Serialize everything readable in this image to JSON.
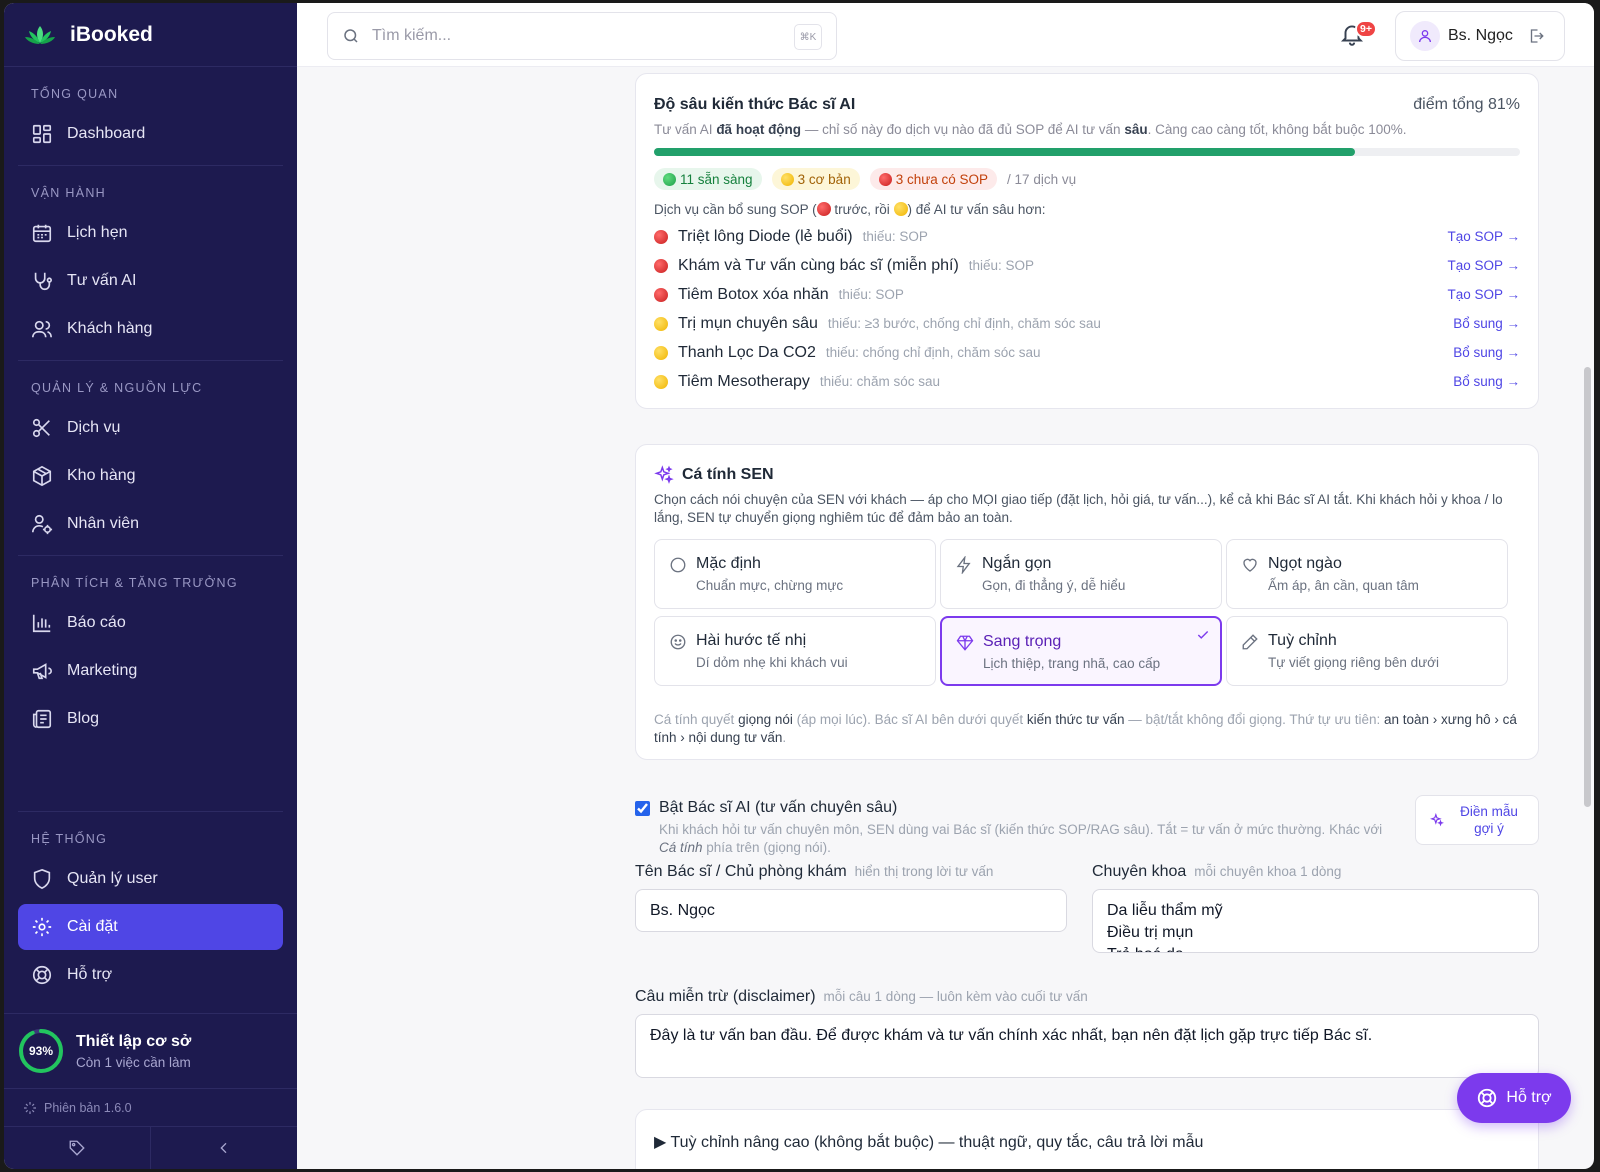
{
  "brand": {
    "name": "iBooked"
  },
  "sidebar": {
    "sections": [
      {
        "label": "TỔNG QUAN",
        "items": [
          {
            "label": "Dashboard",
            "icon": "dashboard-icon"
          }
        ]
      },
      {
        "label": "VẬN HÀNH",
        "items": [
          {
            "label": "Lịch hẹn",
            "icon": "calendar-icon"
          },
          {
            "label": "Tư vấn AI",
            "icon": "stethoscope-icon"
          },
          {
            "label": "Khách hàng",
            "icon": "users-icon"
          }
        ]
      },
      {
        "label": "QUẢN LÝ & NGUỒN LỰC",
        "items": [
          {
            "label": "Dịch vụ",
            "icon": "scissors-icon"
          },
          {
            "label": "Kho hàng",
            "icon": "box-icon"
          },
          {
            "label": "Nhân viên",
            "icon": "user-gear-icon"
          }
        ]
      },
      {
        "label": "PHÂN TÍCH & TĂNG TRƯỞNG",
        "items": [
          {
            "label": "Báo cáo",
            "icon": "bar-chart-icon"
          },
          {
            "label": "Marketing",
            "icon": "megaphone-icon"
          },
          {
            "label": "Blog",
            "icon": "newspaper-icon"
          }
        ]
      },
      {
        "label": "HỆ THỐNG",
        "items": [
          {
            "label": "Quản lý user",
            "icon": "shield-icon"
          },
          {
            "label": "Cài đặt",
            "icon": "gear-icon",
            "active": true
          },
          {
            "label": "Hỗ trợ",
            "icon": "lifebuoy-icon"
          }
        ]
      }
    ],
    "setup": {
      "percent_label": "93%",
      "percent": 0.93,
      "title": "Thiết lập cơ sở",
      "subtitle": "Còn 1 việc cần làm"
    },
    "version": "Phiên bản 1.6.0"
  },
  "topbar": {
    "search_placeholder": "Tìm kiếm...",
    "shortcut": "⌘K",
    "notif_badge": "9+",
    "user_name": "Bs. Ngọc"
  },
  "knowledge": {
    "title": "Độ sâu kiến thức Bác sĩ AI",
    "score": "điểm tổng 81%",
    "score_value": 0.81,
    "sub_a": "Tư vấn AI ",
    "sub_b": "đã hoạt động",
    "sub_c": " — chỉ số này đo dịch vụ nào đã đủ SOP để AI tư vấn ",
    "sub_d": "sâu",
    "sub_e": ". Càng cao càng tốt, không bắt buộc 100%.",
    "pill_ready": "11 sẵn sàng",
    "pill_basic": "3 cơ bản",
    "pill_nosop": "3 chưa có SOP",
    "total": "/ 17 dịch vụ",
    "list_title_a": "Dịch vụ cần bổ sung SOP (",
    "list_title_b": " trước, rồi ",
    "list_title_c": ") để AI tư vấn sâu hơn:",
    "services": [
      {
        "status": "red",
        "name": "Triệt lông Diode (lẻ buổi)",
        "missing": "thiếu: SOP",
        "action": "Tạo SOP →"
      },
      {
        "status": "red",
        "name": "Khám và Tư vấn cùng bác sĩ (miễn phí)",
        "missing": "thiếu: SOP",
        "action": "Tạo SOP →"
      },
      {
        "status": "red",
        "name": "Tiêm Botox xóa nhăn",
        "missing": "thiếu: SOP",
        "action": "Tạo SOP →"
      },
      {
        "status": "yellow",
        "name": "Trị mụn chuyên sâu",
        "missing": "thiếu: ≥3 bước, chống chỉ định, chăm sóc sau",
        "action": "Bổ sung →"
      },
      {
        "status": "yellow",
        "name": "Thanh Lọc Da CO2",
        "missing": "thiếu: chống chỉ định, chăm sóc sau",
        "action": "Bổ sung →"
      },
      {
        "status": "yellow",
        "name": "Tiêm Mesotherapy",
        "missing": "thiếu: chăm sóc sau",
        "action": "Bổ sung →"
      }
    ]
  },
  "personality": {
    "title": "Cá tính SEN",
    "desc": "Chọn cách nói chuyện của SEN với khách — áp cho MỌI giao tiếp (đặt lịch, hỏi giá, tư vấn...), kể cả khi Bác sĩ AI tắt. Khi khách hỏi y khoa / lo lắng, SEN tự chuyển giọng nghiêm túc để đảm bảo an toàn.",
    "options": [
      {
        "title": "Mặc định",
        "sub": "Chuẩn mực, chừng mực",
        "icon": "circle-icon"
      },
      {
        "title": "Ngắn gọn",
        "sub": "Gọn, đi thẳng ý, dễ hiểu",
        "icon": "lightning-icon"
      },
      {
        "title": "Ngọt ngào",
        "sub": "Ấm áp, ân cần, quan tâm",
        "icon": "heart-icon"
      },
      {
        "title": "Hài hước tế nhị",
        "sub": "Dí dỏm nhẹ khi khách vui",
        "icon": "smile-icon"
      },
      {
        "title": "Sang trọng",
        "sub": "Lịch thiệp, trang nhã, cao cấp",
        "icon": "diamond-icon",
        "selected": true
      },
      {
        "title": "Tuỳ chỉnh",
        "sub": "Tự viết giọng riêng bên dưới",
        "icon": "pencil-icon"
      }
    ],
    "note_a": "Cá tính quyết ",
    "note_b": "giọng nói",
    "note_c": " (áp mọi lúc). Bác sĩ AI bên dưới quyết ",
    "note_d": "kiến thức tư vấn",
    "note_e": " — bật/tắt không đổi giọng. Thứ tự ưu tiên: ",
    "note_f": "an toàn › xưng hô › cá tính › nội dung tư vấn",
    "note_g": "."
  },
  "ai_doctor": {
    "toggle_label": "Bật Bác sĩ AI (tư vấn chuyên sâu)",
    "hint_a": "Khi khách hỏi tư vấn chuyên môn, SEN dùng vai Bác sĩ (kiến thức SOP/RAG sâu). Tắt = tư vấn ở mức thường. Khác với ",
    "hint_b": "Cá tính",
    "hint_c": " phía trên (giọng nói).",
    "fill_button": "Điền mẫu gợi ý",
    "doctor_label": "Tên Bác sĩ / Chủ phòng khám",
    "doctor_hint": "hiển thị trong lời tư vấn",
    "doctor_value": "Bs. Ngọc",
    "specialty_label": "Chuyên khoa",
    "specialty_hint": "mỗi chuyên khoa 1 dòng",
    "specialty_value": "Da liễu thẩm mỹ\nĐiều trị mụn\nTrẻ hoá da",
    "disclaimer_label": "Câu miễn trừ (disclaimer)",
    "disclaimer_hint": "mỗi câu 1 dòng — luôn kèm vào cuối tư vấn",
    "disclaimer_value": "Đây là tư vấn ban đầu. Để được khám và tư vấn chính xác nhất, bạn nên đặt lịch gặp trực tiếp Bác sĩ.",
    "advanced": "▶ Tuỳ chỉnh nâng cao (không bắt buộc) — thuật ngữ, quy tắc, câu trả lời mẫu"
  },
  "help_button": "Hỗ trợ"
}
